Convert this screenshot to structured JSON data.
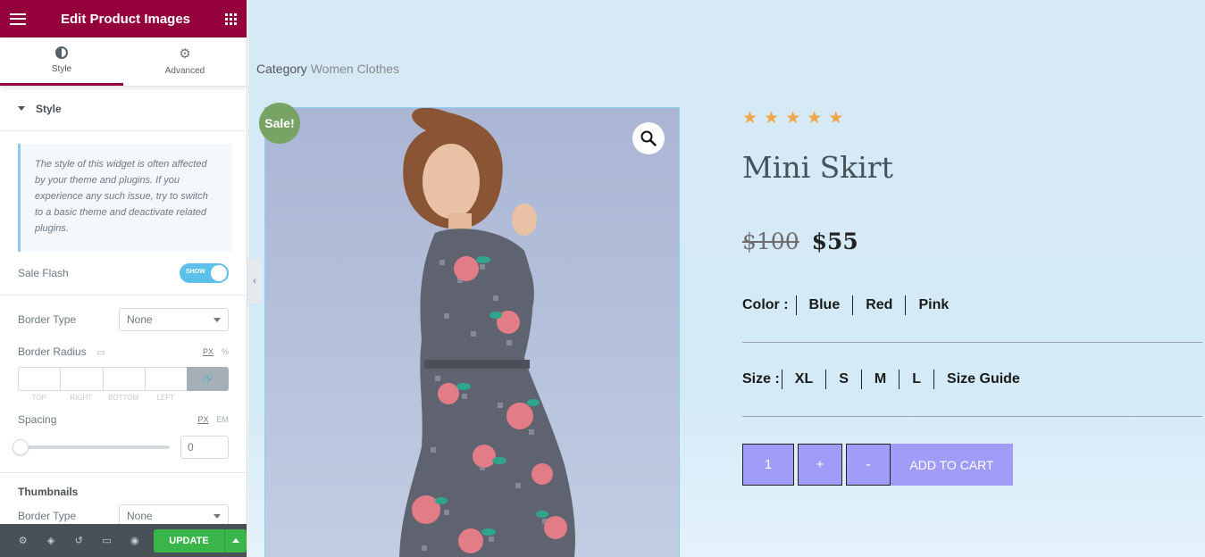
{
  "panel": {
    "title": "Edit Product Images",
    "tabs": [
      {
        "label": "Style",
        "icon": "contrast-icon",
        "active": true
      },
      {
        "label": "Advanced",
        "icon": "gear-icon",
        "active": false
      }
    ],
    "section_title": "Style",
    "notice": "The style of this widget is often affected by your theme and plugins. If you experience any such issue, try to switch to a basic theme and deactivate related plugins.",
    "sale_flash": {
      "label": "Sale Flash",
      "toggle": "SHOW"
    },
    "border_type": {
      "label": "Border Type",
      "value": "None"
    },
    "border_radius": {
      "label": "Border Radius",
      "units": [
        "PX",
        "%"
      ],
      "fields": [
        "TOP",
        "RIGHT",
        "BOTTOM",
        "LEFT"
      ]
    },
    "spacing": {
      "label": "Spacing",
      "units": [
        "PX",
        "EM"
      ],
      "value": "0"
    },
    "thumbnails": {
      "label": "Thumbnails",
      "border_type_label": "Border Type",
      "border_type_value": "None"
    },
    "footer": {
      "update": "UPDATE"
    }
  },
  "preview": {
    "category_label": "Category",
    "category_value": "Women Clothes",
    "sale_badge": "Sale!",
    "rating": 5,
    "title": "Mini Skirt",
    "price_old": "$100",
    "price_new": "$55",
    "color_label": "Color :",
    "colors": [
      "Blue",
      "Red",
      "Pink"
    ],
    "size_label": "Size :",
    "sizes": [
      "XL",
      "S",
      "M",
      "L",
      "Size Guide"
    ],
    "quantity": "1",
    "plus": "+",
    "minus": "-",
    "add_to_cart": "ADD TO CART"
  },
  "colors": {
    "brand": "#93003c",
    "update": "#39b54a",
    "toggle": "#5bc0eb",
    "cart": "#a19cf8",
    "star": "#f0a644",
    "sale": "#77a464"
  }
}
